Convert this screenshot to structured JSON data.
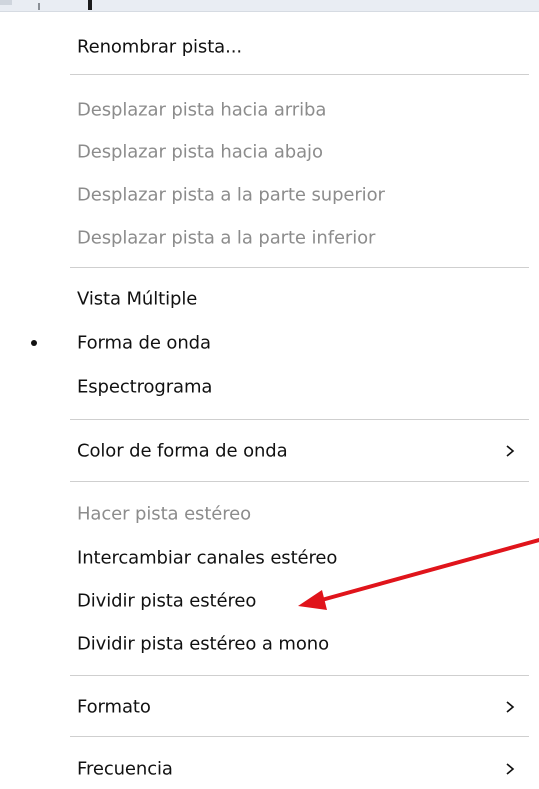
{
  "menu": {
    "items": [
      {
        "label": "Renombrar pista...",
        "enabled": true
      },
      {
        "label": "Desplazar pista hacia arriba",
        "enabled": false
      },
      {
        "label": "Desplazar pista hacia abajo",
        "enabled": false
      },
      {
        "label": "Desplazar pista a la parte superior",
        "enabled": false
      },
      {
        "label": "Desplazar pista a la parte inferior",
        "enabled": false
      },
      {
        "label": "Vista Múltiple",
        "enabled": true
      },
      {
        "label": "Forma de onda",
        "enabled": true,
        "checked": true
      },
      {
        "label": "Espectrograma",
        "enabled": true
      },
      {
        "label": "Color de forma de onda",
        "enabled": true,
        "submenu": true
      },
      {
        "label": "Hacer pista estéreo",
        "enabled": false
      },
      {
        "label": "Intercambiar canales estéreo",
        "enabled": true
      },
      {
        "label": "Dividir pista estéreo",
        "enabled": true
      },
      {
        "label": "Dividir pista estéreo a mono",
        "enabled": true
      },
      {
        "label": "Formato",
        "enabled": true,
        "submenu": true
      },
      {
        "label": "Frecuencia",
        "enabled": true,
        "submenu": true
      }
    ]
  },
  "colors": {
    "text": "#111111",
    "disabled_text": "#8c8c8c",
    "separator": "#cfcfcf",
    "annotation_arrow": "#e0141b"
  },
  "icons": {
    "checked_marker": "bullet-dot-icon",
    "submenu": "chevron-right-icon",
    "annotation": "red-arrow-icon"
  }
}
